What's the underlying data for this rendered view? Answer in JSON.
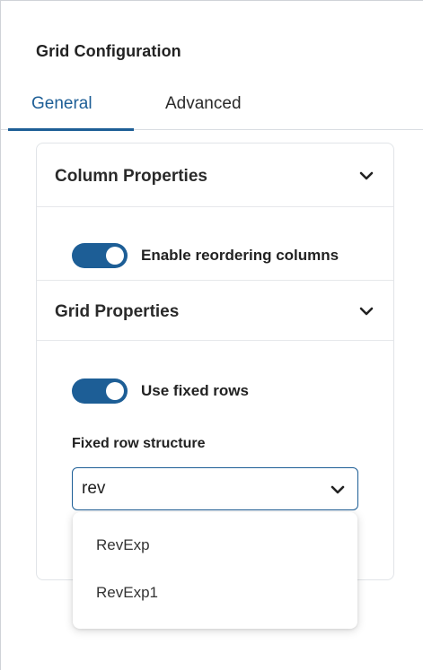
{
  "panel": {
    "title": "Grid Configuration"
  },
  "tabs": [
    {
      "label": "General",
      "active": true
    },
    {
      "label": "Advanced",
      "active": false
    }
  ],
  "sections": {
    "column_properties": {
      "title": "Column Properties",
      "expanded": true,
      "toggle_label": "Enable reordering columns",
      "toggle_on": true
    },
    "grid_properties": {
      "title": "Grid Properties",
      "expanded": true,
      "toggle_label": "Use fixed rows",
      "toggle_on": true,
      "field_label": "Fixed row structure",
      "field_value": "rev"
    }
  },
  "dropdown": {
    "options": [
      "RevExp",
      "RevExp1"
    ]
  },
  "colors": {
    "accent": "#1d5e96",
    "border": "#e1e4e8",
    "text": "#222222"
  },
  "icons": {
    "section_toggle": "chevron-down-icon",
    "select_open": "chevron-down-icon"
  }
}
